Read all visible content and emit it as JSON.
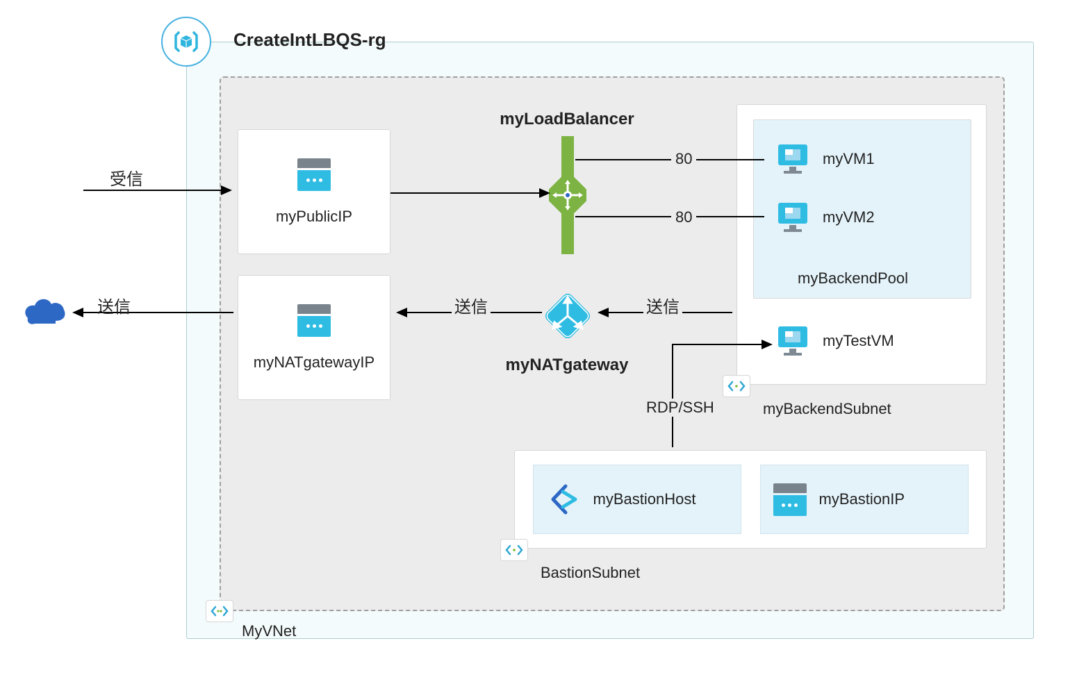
{
  "rg": {
    "title": "CreateIntLBQS-rg"
  },
  "vnet": {
    "name": "MyVNet"
  },
  "publicIP": {
    "name": "myPublicIP"
  },
  "natGatewayIP": {
    "name": "myNATgatewayIP"
  },
  "loadBalancer": {
    "name": "myLoadBalancer"
  },
  "natGateway": {
    "name": "myNATgateway"
  },
  "backendSubnet": {
    "name": "myBackendSubnet"
  },
  "backendPool": {
    "name": "myBackendPool",
    "vms": [
      "myVM1",
      "myVM2"
    ],
    "port": "80"
  },
  "testVM": {
    "name": "myTestVM"
  },
  "bastionSubnet": {
    "name": "BastionSubnet",
    "host": "myBastionHost",
    "ip": "myBastionIP"
  },
  "labels": {
    "inbound": "受信",
    "outbound": "送信",
    "rdpssh": "RDP/SSH"
  }
}
